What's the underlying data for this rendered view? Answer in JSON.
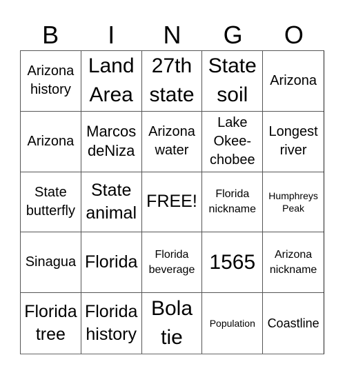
{
  "header": [
    "B",
    "I",
    "N",
    "G",
    "O"
  ],
  "cells": [
    {
      "text": "Arizona\nhistory",
      "size": "s-n"
    },
    {
      "text": "Land\nArea",
      "size": "s-xl"
    },
    {
      "text": "27th\nstate",
      "size": "s-xl"
    },
    {
      "text": "State\nsoil",
      "size": "s-xl"
    },
    {
      "text": "Arizona",
      "size": "s-n"
    },
    {
      "text": "Arizona",
      "size": "s-n"
    },
    {
      "text": "Marcos\ndeNiza",
      "size": "s-m"
    },
    {
      "text": "Arizona\nwater",
      "size": "s-n"
    },
    {
      "text": "Lake\nOkee-\nchobee",
      "size": "s-n"
    },
    {
      "text": "Longest\nriver",
      "size": "s-n"
    },
    {
      "text": "State\nbutterfly",
      "size": "s-n"
    },
    {
      "text": "State\nanimal",
      "size": "s-l"
    },
    {
      "text": "FREE!",
      "size": "s-l"
    },
    {
      "text": "Florida\nnickname",
      "size": "s-xs"
    },
    {
      "text": "Humphreys\nPeak",
      "size": "s-xxs"
    },
    {
      "text": "Sinagua",
      "size": "s-n"
    },
    {
      "text": "Florida",
      "size": "s-l"
    },
    {
      "text": "Florida\nbeverage",
      "size": "s-xs"
    },
    {
      "text": "1565",
      "size": "s-xl"
    },
    {
      "text": "Arizona\nnickname",
      "size": "s-xs"
    },
    {
      "text": "Florida\ntree",
      "size": "s-l"
    },
    {
      "text": "Florida\nhistory",
      "size": "s-l"
    },
    {
      "text": "Bola\ntie",
      "size": "s-xl"
    },
    {
      "text": "Population",
      "size": "s-xxs"
    },
    {
      "text": "Coastline",
      "size": "s-s"
    }
  ]
}
